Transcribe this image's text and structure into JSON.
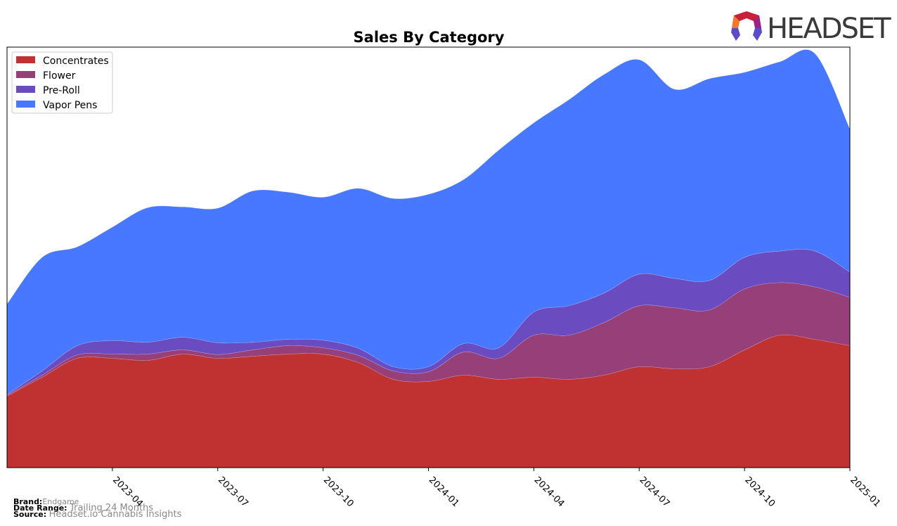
{
  "chart_data": {
    "type": "area",
    "stacked": true,
    "title": "Sales By Category",
    "xlabel": "",
    "ylabel": "",
    "x": [
      "2023-01",
      "2023-02",
      "2023-03",
      "2023-04",
      "2023-05",
      "2023-06",
      "2023-07",
      "2023-08",
      "2023-09",
      "2023-10",
      "2023-11",
      "2023-12",
      "2024-01",
      "2024-02",
      "2024-03",
      "2024-04",
      "2024-05",
      "2024-06",
      "2024-07",
      "2024-08",
      "2024-09",
      "2024-10",
      "2024-11",
      "2024-12",
      "2025-01"
    ],
    "x_ticks": [
      "2023-04",
      "2023-07",
      "2023-10",
      "2024-01",
      "2024-04",
      "2024-07",
      "2024-10",
      "2025-01"
    ],
    "y_ticks_visible": false,
    "ylim": [
      0,
      100
    ],
    "grid": false,
    "legend_position": "top-left",
    "series": [
      {
        "name": "Concentrates",
        "color": "#c03232",
        "values": [
          17,
          21.5,
          26,
          26,
          25.5,
          27,
          26,
          26.5,
          27,
          27,
          25,
          21,
          20.5,
          22,
          21,
          21.5,
          21,
          22,
          24,
          23.5,
          24,
          28,
          31.5,
          30.5,
          29
        ]
      },
      {
        "name": "Flower",
        "color": "#963f78",
        "values": [
          0.2,
          0.5,
          0.8,
          1.0,
          1.5,
          1.0,
          0.9,
          1.5,
          2.0,
          1.5,
          1.7,
          2.0,
          2.3,
          5.5,
          5.0,
          10.0,
          10.5,
          12.5,
          14.5,
          14.5,
          13.5,
          14.5,
          12.5,
          12.5,
          11.5
        ]
      },
      {
        "name": "Pre-Roll",
        "color": "#6a4cc0",
        "values": [
          0.2,
          1.0,
          2.2,
          3.2,
          2.8,
          3.0,
          2.8,
          1.8,
          1.5,
          1.8,
          1.7,
          1.0,
          1.2,
          2.0,
          2.5,
          5.5,
          7.0,
          7.0,
          7.5,
          7.0,
          7.0,
          7.5,
          7.5,
          8.5,
          6.0
        ]
      },
      {
        "name": "Vapor Pens",
        "color": "#4878ff",
        "values": [
          21.5,
          27,
          23.5,
          27,
          32,
          31,
          32,
          36,
          35,
          34,
          38,
          40,
          41,
          39,
          47,
          45,
          49,
          52,
          51,
          45,
          48,
          44,
          45,
          47,
          34
        ]
      }
    ]
  },
  "meta": {
    "brand_label": "Brand:",
    "brand_value": "Endgame",
    "date_range_label": "Date Range:",
    "date_range_value": "Trailing 24 Months",
    "source_label": "Source:",
    "source_value": "Headset.io Cannabis Insights"
  },
  "logo": {
    "text": "HEADSET"
  }
}
